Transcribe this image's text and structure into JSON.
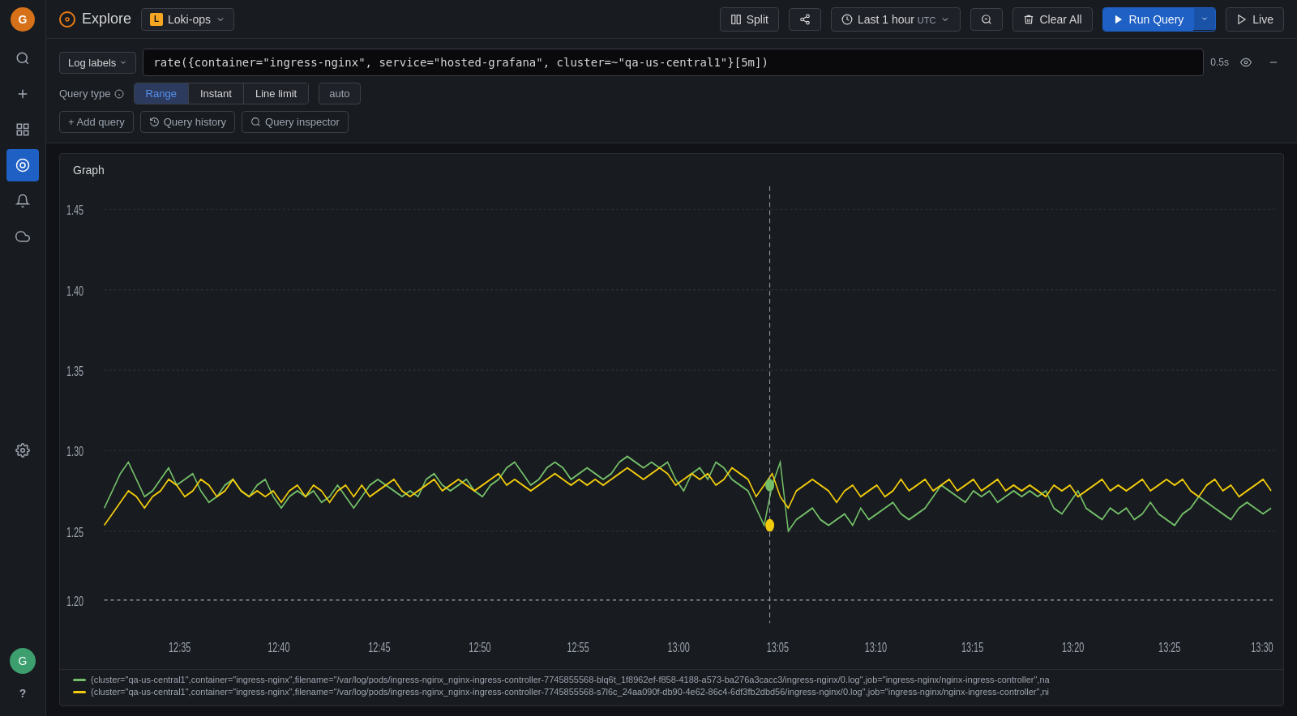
{
  "sidebar": {
    "logo_title": "Grafana",
    "items": [
      {
        "id": "search",
        "icon": "🔍",
        "label": "Search"
      },
      {
        "id": "add",
        "icon": "+",
        "label": "Add"
      },
      {
        "id": "dashboards",
        "icon": "⊞",
        "label": "Dashboards"
      },
      {
        "id": "explore",
        "icon": "◎",
        "label": "Explore",
        "active": true
      },
      {
        "id": "alerts",
        "icon": "🔔",
        "label": "Alerts"
      },
      {
        "id": "cloud",
        "icon": "☁",
        "label": "Cloud"
      },
      {
        "id": "settings",
        "icon": "⚙",
        "label": "Settings"
      }
    ],
    "bottom_items": [
      {
        "id": "avatar",
        "label": "User"
      },
      {
        "id": "help",
        "icon": "?",
        "label": "Help"
      }
    ]
  },
  "topnav": {
    "explore_label": "Explore",
    "datasource": {
      "name": "Loki-ops",
      "icon": "L"
    },
    "buttons": {
      "split": "Split",
      "time_range": "Last 1 hour",
      "time_range_suffix": "UTC",
      "zoom": "",
      "clear_all": "Clear All",
      "run_query": "Run Query",
      "live": "Live"
    }
  },
  "query": {
    "log_labels_btn": "Log labels",
    "query_text": "rate({container=\"ingress-nginx\", service=\"hosted-grafana\", cluster=~\"qa-us-central1\"}[5m])",
    "query_text_display": "rate({container=\"ingress-nginx\", service=\"hosted-grafana\", cluster=~\"qa-us-central1\"}[5m])",
    "timing": "0.5s",
    "query_type_label": "Query type",
    "query_modes": [
      "Range",
      "Instant",
      "Line limit"
    ],
    "active_mode": "Range",
    "auto_placeholder": "auto",
    "toolbar": {
      "add_query": "+ Add query",
      "query_history": "Query history",
      "query_inspector": "Query inspector"
    }
  },
  "graph": {
    "title": "Graph",
    "y_labels": [
      "1.45",
      "1.40",
      "1.35",
      "1.30",
      "1.25",
      "1.20"
    ],
    "x_labels": [
      "12:35",
      "12:40",
      "12:45",
      "12:50",
      "12:55",
      "13:00",
      "13:05",
      "13:10",
      "13:15",
      "13:20",
      "13:25",
      "13:30"
    ],
    "legend": [
      {
        "color": "#73bf69",
        "text": "{cluster=\"qa-us-central1\",container=\"ingress-nginx\",filename=\"/var/log/pods/ingress-nginx_nginx-ingress-controller-7745855568-blq6t_1f8962ef-f858-4188-a573-ba276a3cacc3/ingress-nginx/0.log\",job=\"ingress-nginx/nginx-ingress-controller\",na"
      },
      {
        "color": "#f2cc0c",
        "text": "{cluster=\"qa-us-central1\",container=\"ingress-nginx\",filename=\"/var/log/pods/ingress-nginx_nginx-ingress-controller-7745855568-s7l6c_24aa090f-db90-4e62-86c4-6df3fb2dbd56/ingress-nginx/0.log\",job=\"ingress-nginx/nginx-ingress-controller\",ni"
      }
    ]
  },
  "colors": {
    "green_line": "#73bf69",
    "yellow_line": "#f2cc0c",
    "bg": "#111217",
    "panel_bg": "#181b1f",
    "accent": "#1f60c4"
  }
}
